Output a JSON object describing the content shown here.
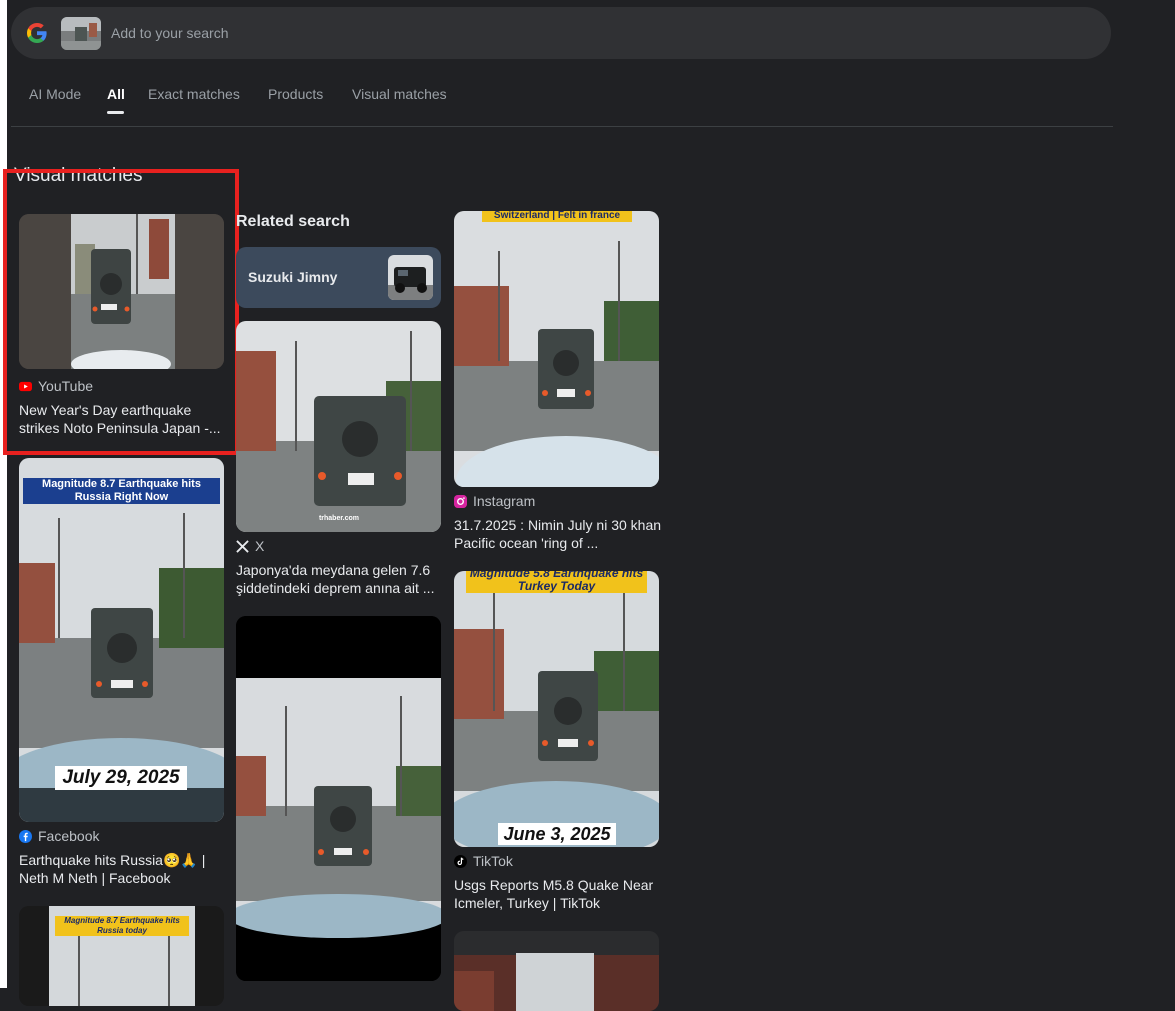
{
  "search": {
    "placeholder": "Add to your search"
  },
  "tabs": [
    {
      "label": "AI Mode"
    },
    {
      "label": "All"
    },
    {
      "label": "Exact matches"
    },
    {
      "label": "Products"
    },
    {
      "label": "Visual matches"
    }
  ],
  "section_title": "Visual matches",
  "related": {
    "title": "Related search",
    "chip_label": "Suzuki Jimny"
  },
  "cards": [
    {
      "source": "YouTube",
      "caption_line1": "New Year's Day earthquake",
      "caption_line2": "strikes Noto Peninsula Japan -..."
    },
    {
      "source": "Facebook",
      "caption_line1": "Earthquake hits Russia🥺🙏 |",
      "caption_line2": "Neth M Neth | Facebook",
      "overlay_top": "Magnitude 8.7 Earthquake hits Russia Right Now",
      "overlay_date": "July 29, 2025"
    },
    {
      "source": "X",
      "caption_line1": "Japonya'da meydana gelen 7.6",
      "caption_line2": "şiddetindeki deprem anına ait ...",
      "watermark": "trhaber.com"
    },
    {
      "source": "Instagram",
      "caption_line1": "31.7.2025 : Nimin July ni 30 khan",
      "caption_line2": "Pacific ocean 'ring of ...",
      "overlay_top": "Switzerland | Felt in france"
    },
    {
      "source": "TikTok",
      "caption_line1": "Usgs Reports M5.8 Quake Near",
      "caption_line2": "Icmeler, Turkey | TikTok",
      "overlay_top": "Magnitude 5.8 Earthquake hits Turkey Today",
      "overlay_date": "June 3, 2025"
    },
    {
      "overlay_top": "Magnitude 8.7 Earthquake hits Russia today"
    }
  ],
  "colors": {
    "highlight": "#e8211f",
    "background": "#202124"
  }
}
